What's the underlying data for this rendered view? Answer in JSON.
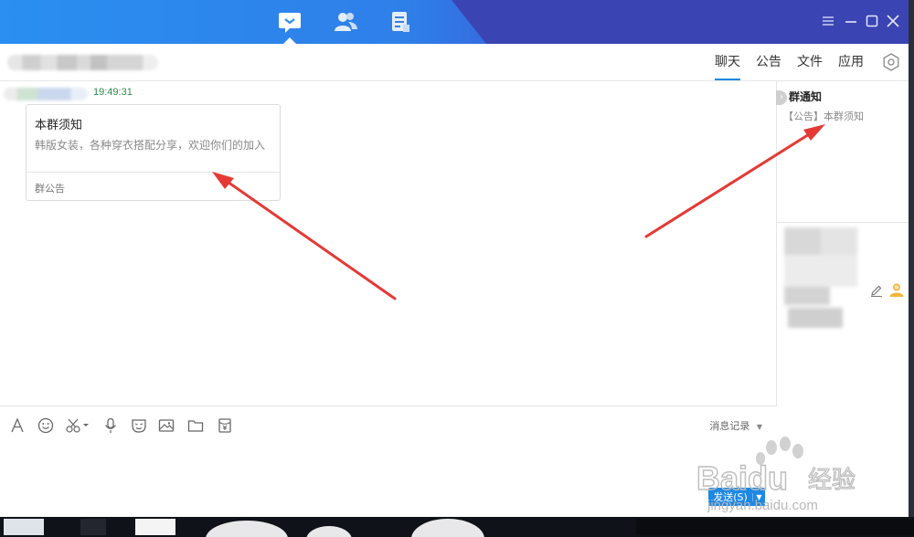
{
  "titlebar": {
    "nav_icons": [
      "chat-icon",
      "contacts-icon",
      "notes-icon"
    ],
    "window_controls": [
      "menu-icon",
      "minimize-icon",
      "maximize-icon",
      "close-icon"
    ],
    "colors": {
      "left": "#2a8ff0",
      "right": "#3a45b3"
    }
  },
  "header": {
    "tabs": [
      {
        "label": "聊天",
        "active": true
      },
      {
        "label": "公告",
        "active": false
      },
      {
        "label": "文件",
        "active": false
      },
      {
        "label": "应用",
        "active": false
      }
    ],
    "accent": "#1e88e5"
  },
  "message": {
    "time": "19:49:31",
    "card": {
      "title": "本群须知",
      "content": "韩版女装，各种穿衣搭配分享，欢迎你们的加入",
      "footer": "群公告"
    }
  },
  "right_panel": {
    "title": "群通知",
    "item": "【公告】本群须知"
  },
  "toolbar": {
    "icons": [
      "font-icon",
      "emoji-icon",
      "screenshot-icon",
      "voice-icon",
      "mask-icon",
      "image-icon",
      "folder-icon",
      "redpacket-icon"
    ],
    "history_label": "消息记录"
  },
  "input": {
    "send_label": "发送(S)"
  },
  "watermark": {
    "brand": "Baidu",
    "brand_cn": "经验",
    "url": "jingyan.baidu.com"
  }
}
